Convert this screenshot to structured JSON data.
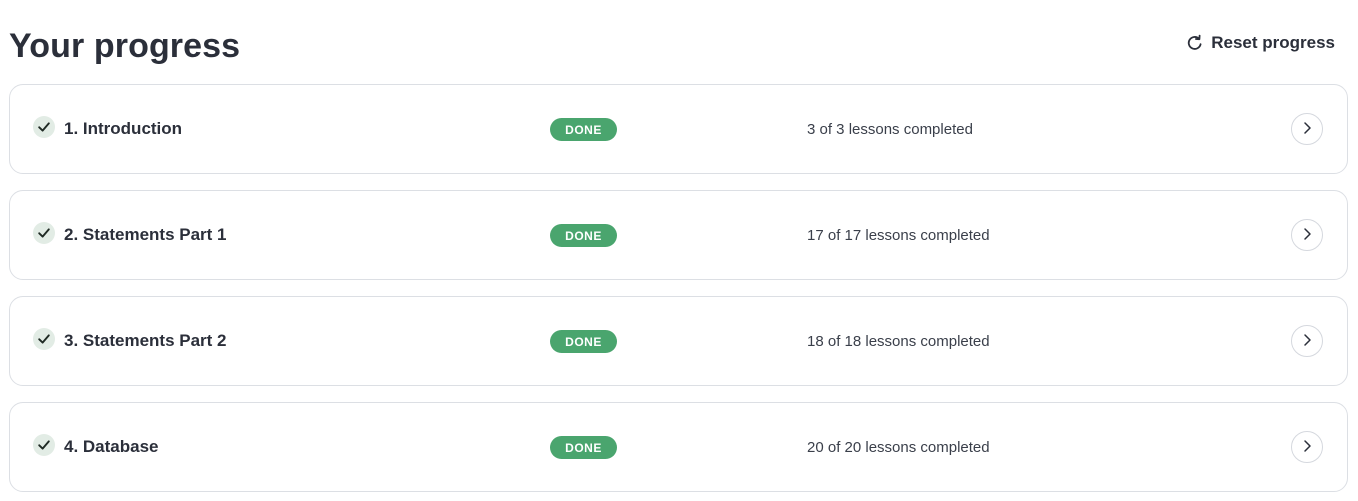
{
  "header": {
    "title": "Your progress",
    "reset_label": "Reset progress",
    "reset_icon": "refresh-icon"
  },
  "colors": {
    "badge_done": "#4aa56e",
    "check_bg": "#e2ece5",
    "text": "#2b2f3a",
    "border": "#dcdfe4"
  },
  "modules": [
    {
      "title": "1. Introduction",
      "status": "DONE",
      "lessons": "3 of 3 lessons completed",
      "completed": 3,
      "total": 3
    },
    {
      "title": "2. Statements Part 1",
      "status": "DONE",
      "lessons": "17 of 17 lessons completed",
      "completed": 17,
      "total": 17
    },
    {
      "title": "3. Statements Part 2",
      "status": "DONE",
      "lessons": "18 of 18 lessons completed",
      "completed": 18,
      "total": 18
    },
    {
      "title": "4. Database",
      "status": "DONE",
      "lessons": "20 of 20 lessons completed",
      "completed": 20,
      "total": 20
    }
  ]
}
